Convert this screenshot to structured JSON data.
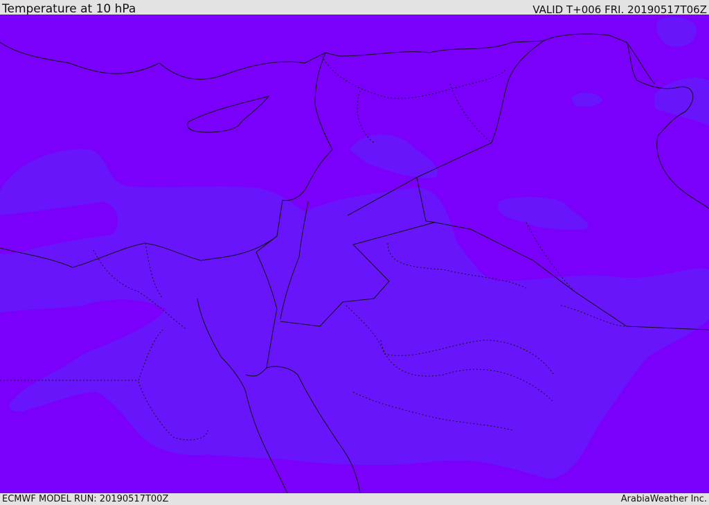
{
  "header": {
    "title": "Temperature at 10 hPa",
    "valid": "VALID T+006 FRI. 20190517T06Z"
  },
  "footer": {
    "model_run": "ECMWF MODEL RUN: 20190517T00Z",
    "credit": "ArabiaWeather Inc."
  },
  "map": {
    "colors": {
      "background_field": "#7a00fb",
      "warm_band": "#6815fb",
      "coastline": "#111111"
    }
  }
}
